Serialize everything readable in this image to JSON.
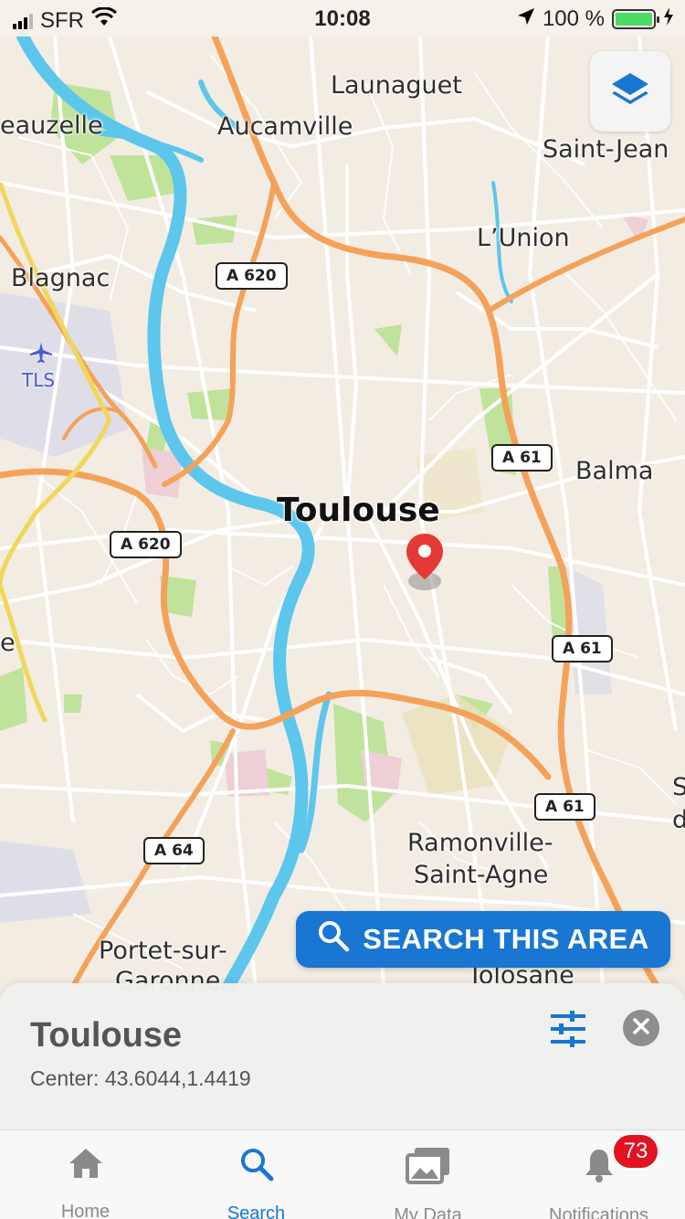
{
  "status_bar": {
    "carrier": "SFR",
    "time": "10:08",
    "battery": "100 %",
    "battery_level": 1.0
  },
  "map": {
    "places": {
      "launaguet": "Launaguet",
      "aucamville": "Aucamville",
      "beauzelle": "eauzelle",
      "saint_jean": "Saint-Jean",
      "lunion": "L’Union",
      "blagnac": "Blagnac",
      "airport_code": "TLS",
      "balma": "Balma",
      "toulouse": "Toulouse",
      "ramonville": "Ramonville-\nSaint-Agne",
      "ramonville_1": "Ramonville-",
      "ramonville_2": "Saint-Agne",
      "portet_1": "Portet-sur-",
      "portet_2": "Garonne",
      "tolosane": "Tolosane",
      "edge_e": "e",
      "edge_s": "S",
      "edge_d": "d"
    },
    "road_shields": {
      "a620_top": "A 620",
      "a620_left": "A 620",
      "a61_1": "A 61",
      "a61_2": "A 61",
      "a61_3": "A 61",
      "a64": "A 64"
    },
    "pin_icon": "map-pin-icon",
    "layers_icon": "layers-icon",
    "colors": {
      "water": "#4fc1e9",
      "highway": "#f4a25a",
      "park": "#b8df8c",
      "road": "#ffffff",
      "pin": "#e53935"
    }
  },
  "search_area_button": {
    "label": "SEARCH THIS AREA",
    "icon": "search-icon"
  },
  "sheet": {
    "title": "Toulouse",
    "subtitle": "Center: 43.6044,1.4419",
    "filter_icon": "sliders-icon",
    "close_icon": "close-icon"
  },
  "tabs": [
    {
      "label": "Home",
      "icon": "home-icon"
    },
    {
      "label": "Search",
      "icon": "search-icon"
    },
    {
      "label": "My Data",
      "icon": "photos-icon"
    },
    {
      "label": "Notifications",
      "icon": "bell-icon"
    }
  ],
  "notifications_badge": "73",
  "accent_color": "#1976d2"
}
